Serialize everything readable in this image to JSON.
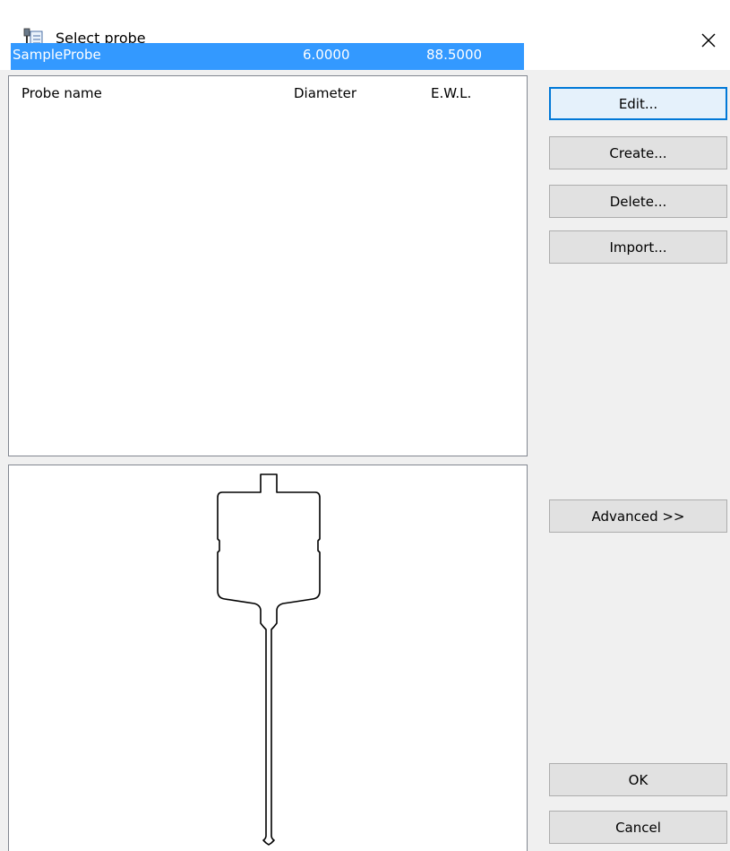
{
  "window": {
    "title": "Select probe",
    "close_glyph": "✕",
    "app_icon": "probe-dialog-icon"
  },
  "probe_list": {
    "columns": {
      "name": "Probe name",
      "diameter": "Diameter",
      "ewl": "E.W.L."
    },
    "rows": [
      {
        "name": "SampleProbe",
        "diameter": "6.0000",
        "ewl": "88.5000",
        "selected": true
      }
    ],
    "selection_color": "#3399ff"
  },
  "buttons": {
    "edit": "Edit...",
    "create": "Create...",
    "delete": "Delete...",
    "import": "Import...",
    "advanced": "Advanced >>",
    "ok": "OK",
    "cancel": "Cancel"
  },
  "preview": {
    "icon": "probe-outline-drawing"
  }
}
